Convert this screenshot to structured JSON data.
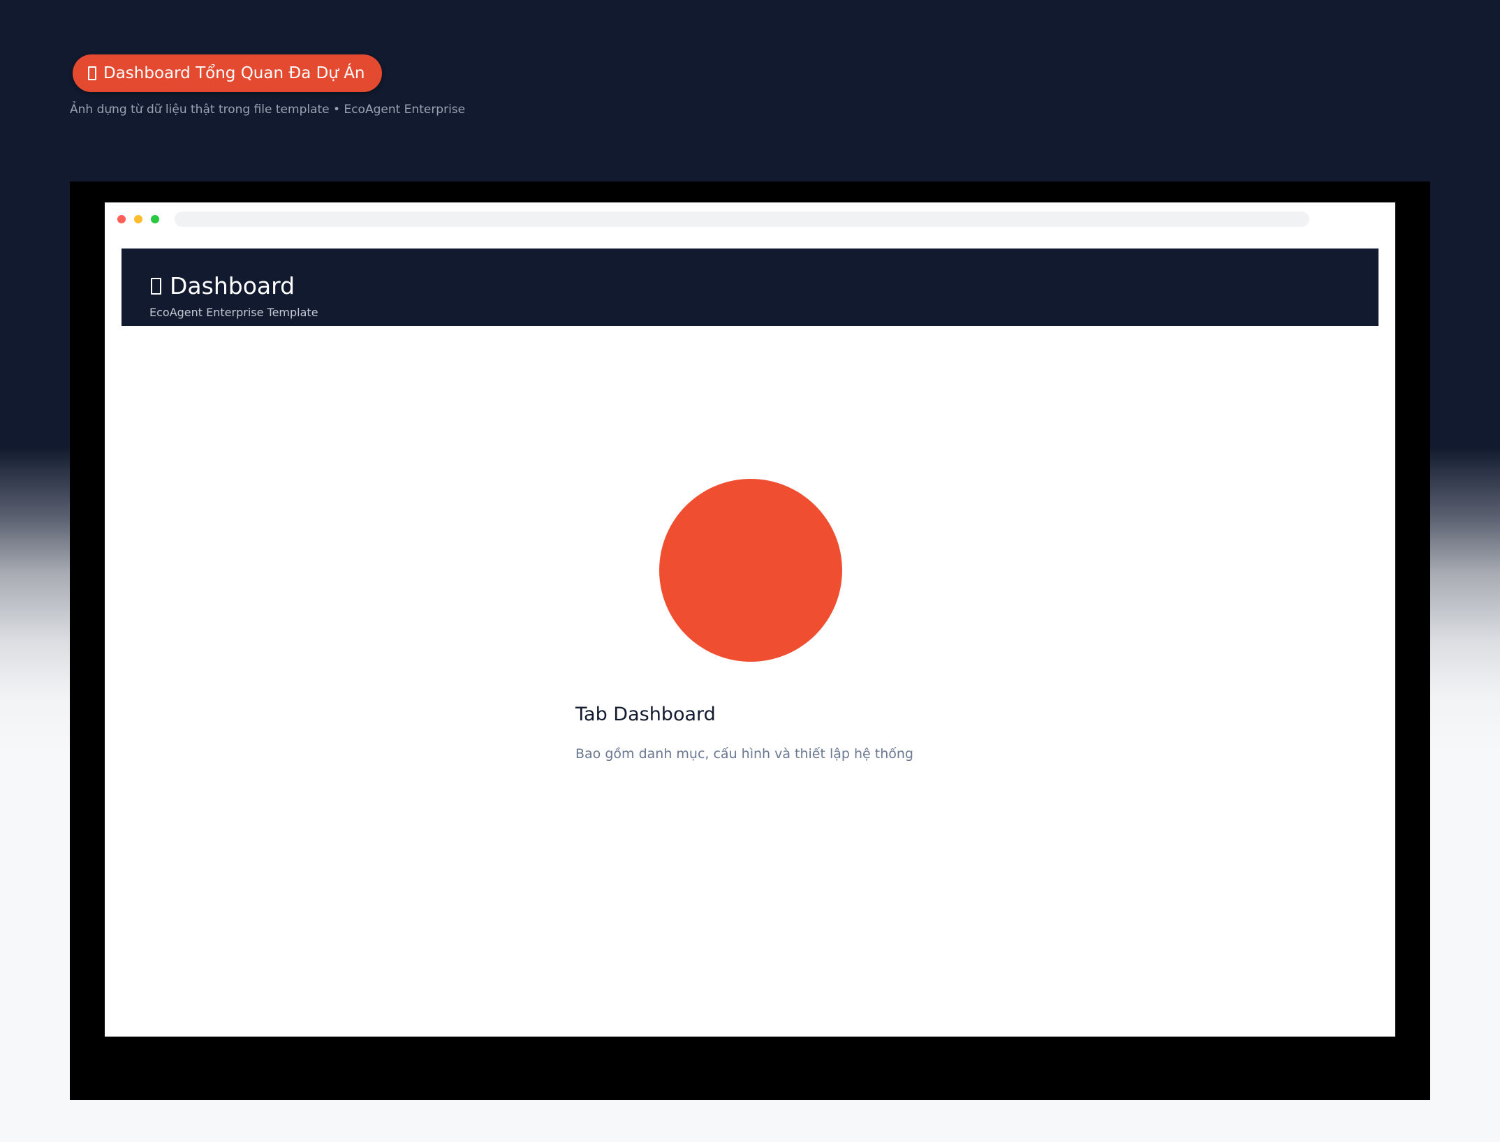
{
  "banner": {
    "icon": "chart-icon",
    "label": "Dashboard Tổng Quan Đa Dự Án",
    "color": "#e34a30"
  },
  "caption": "Ảnh dựng từ dữ liệu thật trong file template • EcoAgent Enterprise",
  "app": {
    "icon": "dashboard-icon",
    "title": "Dashboard",
    "subtitle": "EcoAgent Enterprise Template",
    "header_color": "#111a2e"
  },
  "content": {
    "tab_title": "Tab Dashboard",
    "tab_description": "Bao gồm danh mục, cấu hình và thiết lập hệ thống",
    "accent_color": "#ef4f30"
  }
}
